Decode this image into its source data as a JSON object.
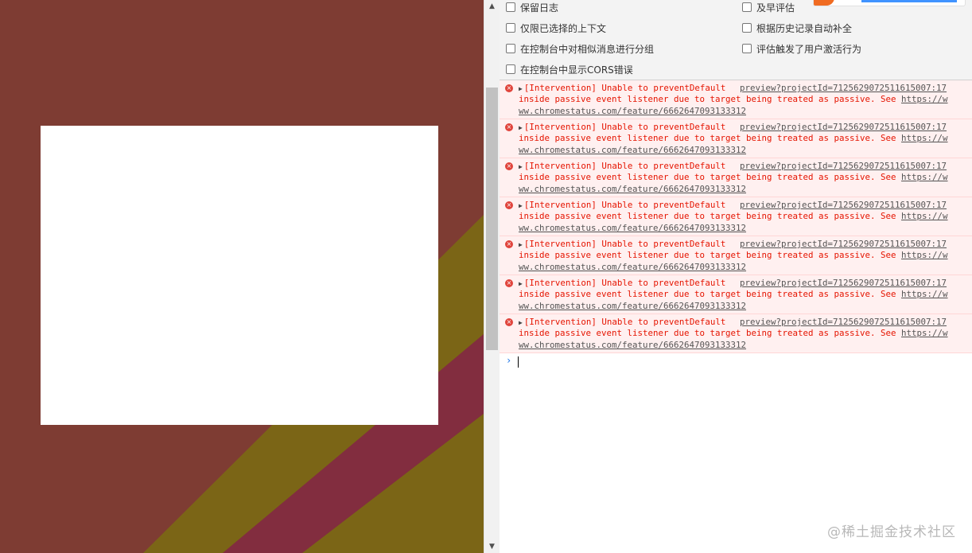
{
  "canvas": {
    "background_color": "#7e3c33",
    "stripe_colors": [
      "#7b6516",
      "#822d3f"
    ]
  },
  "settings": {
    "options_left": [
      {
        "label": "保留日志",
        "checked": false
      },
      {
        "label": "仅限已选择的上下文",
        "checked": false
      },
      {
        "label": "在控制台中对相似消息进行分组",
        "checked": false
      },
      {
        "label": "在控制台中显示CORS错误",
        "checked": false
      }
    ],
    "options_right": [
      {
        "label": "及早评估",
        "checked": false
      },
      {
        "label": "根据历史记录自动补全",
        "checked": false
      },
      {
        "label": "评估触发了用户激活行为",
        "checked": false
      }
    ]
  },
  "console": {
    "messages": [
      {
        "line1": "[Intervention] Unable to preventDefault",
        "source": "preview?projectId=7125629072511615007:17",
        "line2": "inside passive event listener due to target being treated as passive. See ",
        "link_start": "https://w",
        "line3": "ww.chromestatus.com/feature/6662647093133312"
      },
      {
        "line1": "[Intervention] Unable to preventDefault",
        "source": "preview?projectId=7125629072511615007:17",
        "line2": "inside passive event listener due to target being treated as passive. See ",
        "link_start": "https://w",
        "line3": "ww.chromestatus.com/feature/6662647093133312"
      },
      {
        "line1": "[Intervention] Unable to preventDefault",
        "source": "preview?projectId=7125629072511615007:17",
        "line2": "inside passive event listener due to target being treated as passive. See ",
        "link_start": "https://w",
        "line3": "ww.chromestatus.com/feature/6662647093133312"
      },
      {
        "line1": "[Intervention] Unable to preventDefault",
        "source": "preview?projectId=7125629072511615007:17",
        "line2": "inside passive event listener due to target being treated as passive. See ",
        "link_start": "https://w",
        "line3": "ww.chromestatus.com/feature/6662647093133312"
      },
      {
        "line1": "[Intervention] Unable to preventDefault",
        "source": "preview?projectId=7125629072511615007:17",
        "line2": "inside passive event listener due to target being treated as passive. See ",
        "link_start": "https://w",
        "line3": "ww.chromestatus.com/feature/6662647093133312"
      },
      {
        "line1": "[Intervention] Unable to preventDefault",
        "source": "preview?projectId=7125629072511615007:17",
        "line2": "inside passive event listener due to target being treated as passive. See ",
        "link_start": "https://w",
        "line3": "ww.chromestatus.com/feature/6662647093133312"
      },
      {
        "line1": "[Intervention] Unable to preventDefault",
        "source": "preview?projectId=7125629072511615007:17",
        "line2": "inside passive event listener due to target being treated as passive. See ",
        "link_start": "https://w",
        "line3": "ww.chromestatus.com/feature/6662647093133312"
      }
    ],
    "prompt_symbol": "›"
  },
  "watermark": "@稀土掘金技术社区"
}
